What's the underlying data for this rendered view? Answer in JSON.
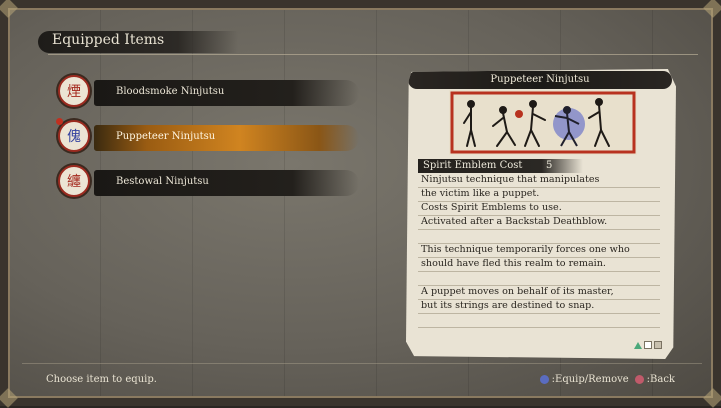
{
  "header": {
    "title": "Equipped Items"
  },
  "items": [
    {
      "label": "Bloodsmoke Ninjutsu",
      "glyph": "煙",
      "icon": "bloodsmoke-emblem",
      "selected": false
    },
    {
      "label": "Puppeteer Ninjutsu",
      "glyph": "傀",
      "icon": "puppeteer-emblem",
      "selected": true
    },
    {
      "label": "Bestowal Ninjutsu",
      "glyph": "纏",
      "icon": "bestowal-emblem",
      "selected": false
    }
  ],
  "detail": {
    "title": "Puppeteer Ninjutsu",
    "stat_label": "Spirit Emblem Cost",
    "stat_value": "5",
    "lines": [
      "Ninjutsu technique that manipulates",
      "the victim like a puppet.",
      "Costs Spirit Emblems to use.",
      "Activated after a Backstab Deathblow.",
      "",
      "This technique temporarily forces one who",
      "should have fled this realm to remain.",
      "",
      "A puppet moves on behalf of its master,",
      "but its strings are destined to snap."
    ]
  },
  "footer": {
    "hint": "Choose item to equip.",
    "equip_label": ":Equip/Remove",
    "back_label": ":Back"
  },
  "colors": {
    "accent": "#d08420",
    "emblem_red": "#a3271c",
    "illustration_bg": "#b8321f"
  }
}
